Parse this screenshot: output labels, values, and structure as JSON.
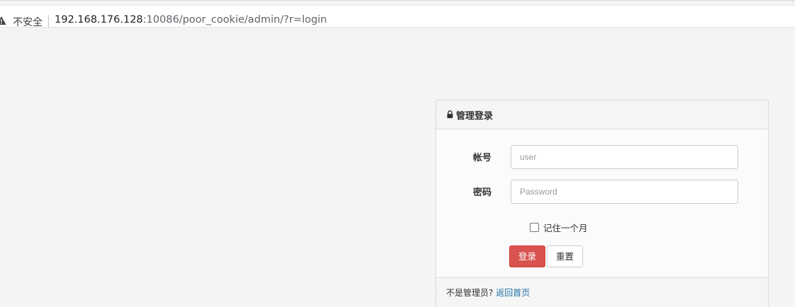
{
  "browser": {
    "security_label": "不安全",
    "url_host": "192.168.176.128",
    "url_rest": ":10086/poor_cookie/admin/?r=login"
  },
  "login_panel": {
    "title": "管理登录",
    "username_label": "帐号",
    "username_placeholder": "user",
    "password_label": "密码",
    "password_placeholder": "Password",
    "remember_label": "记住一个月",
    "login_button": "登录",
    "reset_button": "重置",
    "footer_text": "不是管理员? ",
    "footer_link": "返回首页"
  },
  "colors": {
    "login_button": "#d9534f",
    "link": "#1f6fa8"
  },
  "icons": {
    "security": "warning-triangle-icon",
    "panel": "lock-icon"
  }
}
